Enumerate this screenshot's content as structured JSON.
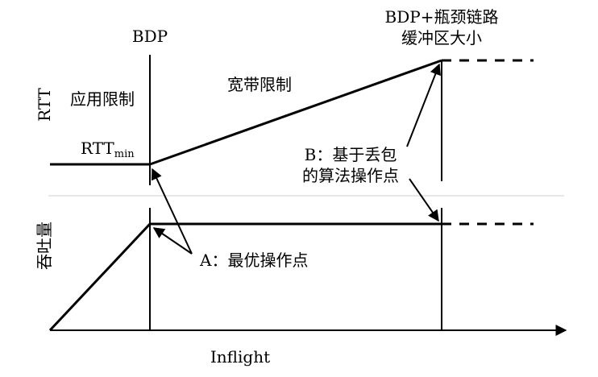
{
  "labels": {
    "bdp_top": "BDP",
    "bdp_buffer_line1": "BDP+瓶颈链路",
    "bdp_buffer_line2": "缓冲区大小",
    "rtt_axis": "RTT",
    "app_limited": "应用限制",
    "bandwidth_limited": "宽带限制",
    "rtt_min_main": "RTT",
    "rtt_min_sub": "min",
    "point_b_line1": "B：基于丢包",
    "point_b_line2": "的算法操作点",
    "throughput_axis": "吞吐量",
    "point_a": "A：最优操作点",
    "x_axis": "Inflight"
  },
  "colors": {
    "line": "#000000",
    "divider": "#d0d0d0",
    "background": "#ffffff"
  }
}
